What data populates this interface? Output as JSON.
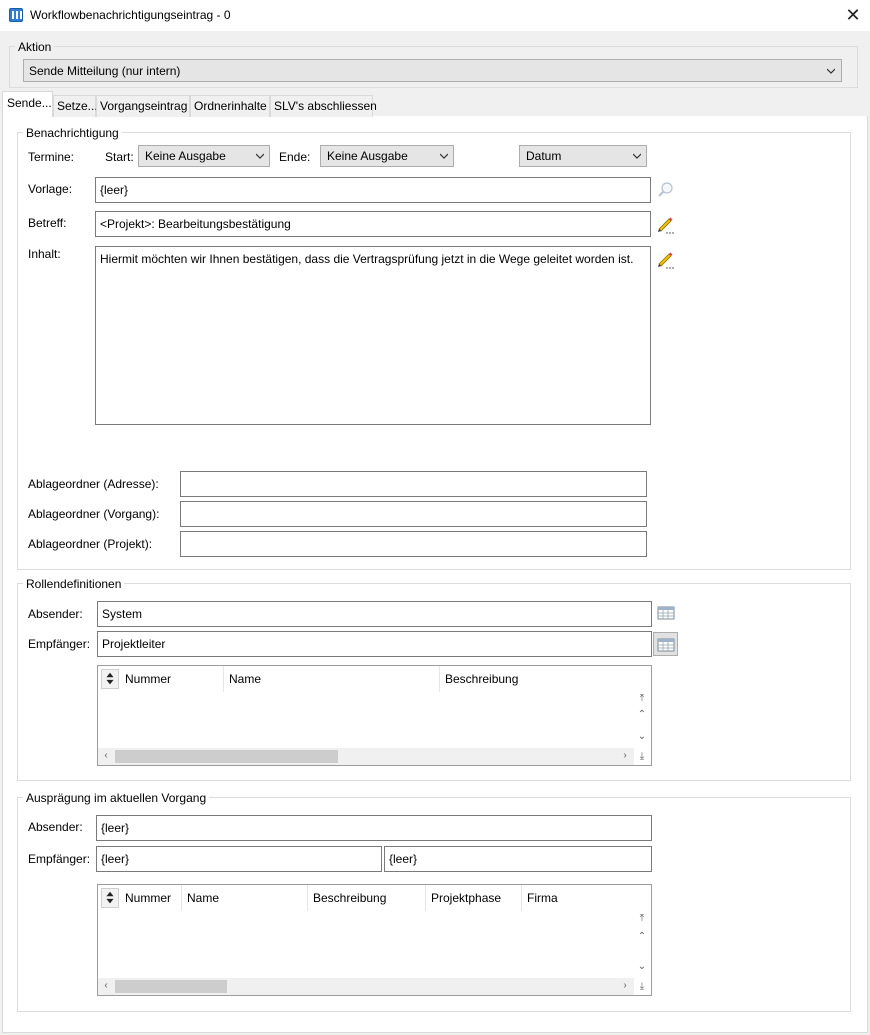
{
  "window": {
    "title": "Workflowbenachrichtigungseintrag - 0",
    "close_glyph": "✕"
  },
  "aktion": {
    "legend": "Aktion",
    "selected": "Sende Mitteilung (nur intern)"
  },
  "tabs": [
    {
      "label": "Sende..."
    },
    {
      "label": "Setze..."
    },
    {
      "label": "Vorgangseintrag"
    },
    {
      "label": "Ordnerinhalte"
    },
    {
      "label": "SLV's abschliessen"
    }
  ],
  "benachrichtigung": {
    "legend": "Benachrichtigung",
    "termine_label": "Termine:",
    "start_label": "Start:",
    "start_value": "Keine Ausgabe",
    "ende_label": "Ende:",
    "ende_value": "Keine Ausgabe",
    "datum_value": "Datum",
    "vorlage_label": "Vorlage:",
    "vorlage_value": "{leer}",
    "betreff_label": "Betreff:",
    "betreff_value": "<Projekt>: Bearbeitungsbestätigung",
    "inhalt_label": "Inhalt:",
    "inhalt_value": "Hiermit möchten wir Ihnen bestätigen, dass die Vertragsprüfung jetzt in die Wege geleitet worden ist.",
    "ablage_adresse_label": "Ablageordner (Adresse):",
    "ablage_adresse_value": "",
    "ablage_vorgang_label": "Ablageordner (Vorgang):",
    "ablage_vorgang_value": "",
    "ablage_projekt_label": "Ablageordner (Projekt):",
    "ablage_projekt_value": ""
  },
  "rollen": {
    "legend": "Rollendefinitionen",
    "absender_label": "Absender:",
    "absender_value": "System",
    "empfaenger_label": "Empfänger:",
    "empfaenger_value": "Projektleiter",
    "columns": [
      "Nummer",
      "Name",
      "Beschreibung"
    ]
  },
  "auspraegung": {
    "legend": "Ausprägung im aktuellen Vorgang",
    "absender_label": "Absender:",
    "absender_value": "{leer}",
    "empfaenger_label": "Empfänger:",
    "empfaenger_value_1": "{leer}",
    "empfaenger_value_2": "{leer}",
    "columns": [
      "Nummer",
      "Name",
      "Beschreibung",
      "Projektphase",
      "Firma"
    ]
  },
  "icons": {
    "app": "app-window-icon",
    "search": "magnifier-icon",
    "edit": "pencil-icon",
    "table": "table-icon",
    "sort": "sort-arrows-icon"
  },
  "colors": {
    "accent": "#2f7fd6",
    "pencil": "#d8a500",
    "thumb": "#cdcdcd"
  }
}
